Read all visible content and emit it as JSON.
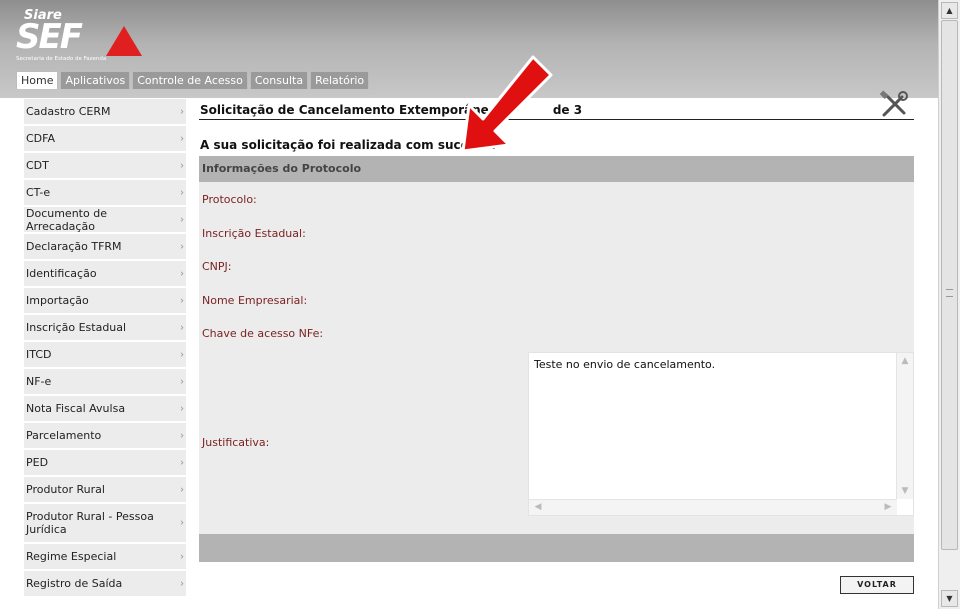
{
  "brand": {
    "product": "Siare",
    "logo_text": "SEF",
    "subtitle": "Secretaria de Estado de Fazenda"
  },
  "colors": {
    "label_red": "#7a1f1f",
    "panel_gray": "#ececec",
    "header_gray": "#b3b3b3",
    "logo_triangle": "#e02020",
    "arrow": "#e01010"
  },
  "tabs": [
    {
      "label": "Home",
      "active": true
    },
    {
      "label": "Aplicativos"
    },
    {
      "label": "Controle de Acesso"
    },
    {
      "label": "Consulta"
    },
    {
      "label": "Relatório"
    }
  ],
  "sidebar": {
    "items": [
      {
        "label": "Cadastro CERM"
      },
      {
        "label": "CDFA"
      },
      {
        "label": "CDT"
      },
      {
        "label": "CT-e"
      },
      {
        "label": "Documento de Arrecadação"
      },
      {
        "label": "Declaração TFRM"
      },
      {
        "label": "Identificação"
      },
      {
        "label": "Importação"
      },
      {
        "label": "Inscrição Estadual"
      },
      {
        "label": "ITCD"
      },
      {
        "label": "NF-e"
      },
      {
        "label": "Nota Fiscal Avulsa"
      },
      {
        "label": "Parcelamento"
      },
      {
        "label": "PED"
      },
      {
        "label": "Produtor Rural"
      },
      {
        "label": "Produtor Rural - Pessoa Jurídica"
      },
      {
        "label": "Regime Especial"
      },
      {
        "label": "Registro de Saída"
      }
    ],
    "chevron": "›"
  },
  "main": {
    "title": "Solicitação de Cancelamento Extemporâne",
    "title_suffix": "de 3",
    "tools_icon": "tools-icon",
    "success_message": "A sua solicitação foi realizada com sucesso.",
    "panel_header": "Informações do Protocolo",
    "fields": {
      "protocolo": "Protocolo:",
      "inscricao": "Inscrição Estadual:",
      "cnpj": "CNPJ:",
      "nome": "Nome Empresarial:",
      "chave": "Chave de acesso NFe:",
      "justificativa": "Justificativa:"
    },
    "justificativa_value": "Teste no envio de cancelamento.",
    "voltar_label": "VOLTAR"
  }
}
